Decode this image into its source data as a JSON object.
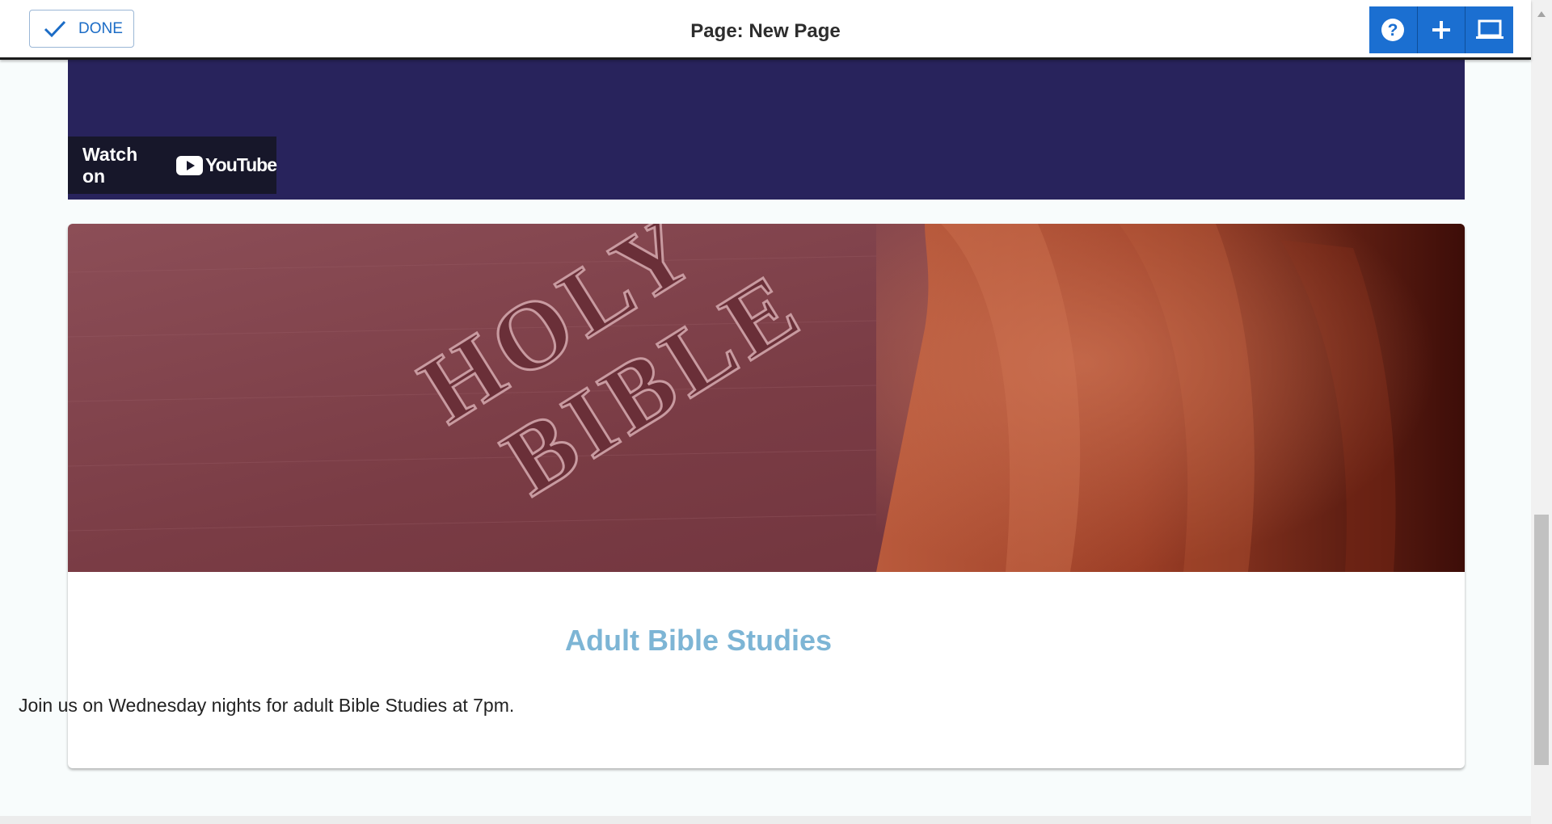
{
  "toolbar": {
    "done_label": "DONE",
    "page_title": "Page: New Page",
    "help_icon": "help-circle-icon",
    "add_icon": "plus-icon",
    "preview_icon": "laptop-icon",
    "accent_color": "#1b6fd1"
  },
  "video": {
    "watch_label": "Watch on",
    "brand": "YouTube",
    "background_color": "#28235c"
  },
  "card": {
    "image_text_line1": "HOLY",
    "image_text_line2": "BIBLE",
    "heading": "Adult Bible Studies",
    "body": "Join us on Wednesday nights for adult Bible Studies at 7pm.",
    "heading_color": "#7db5d5"
  }
}
